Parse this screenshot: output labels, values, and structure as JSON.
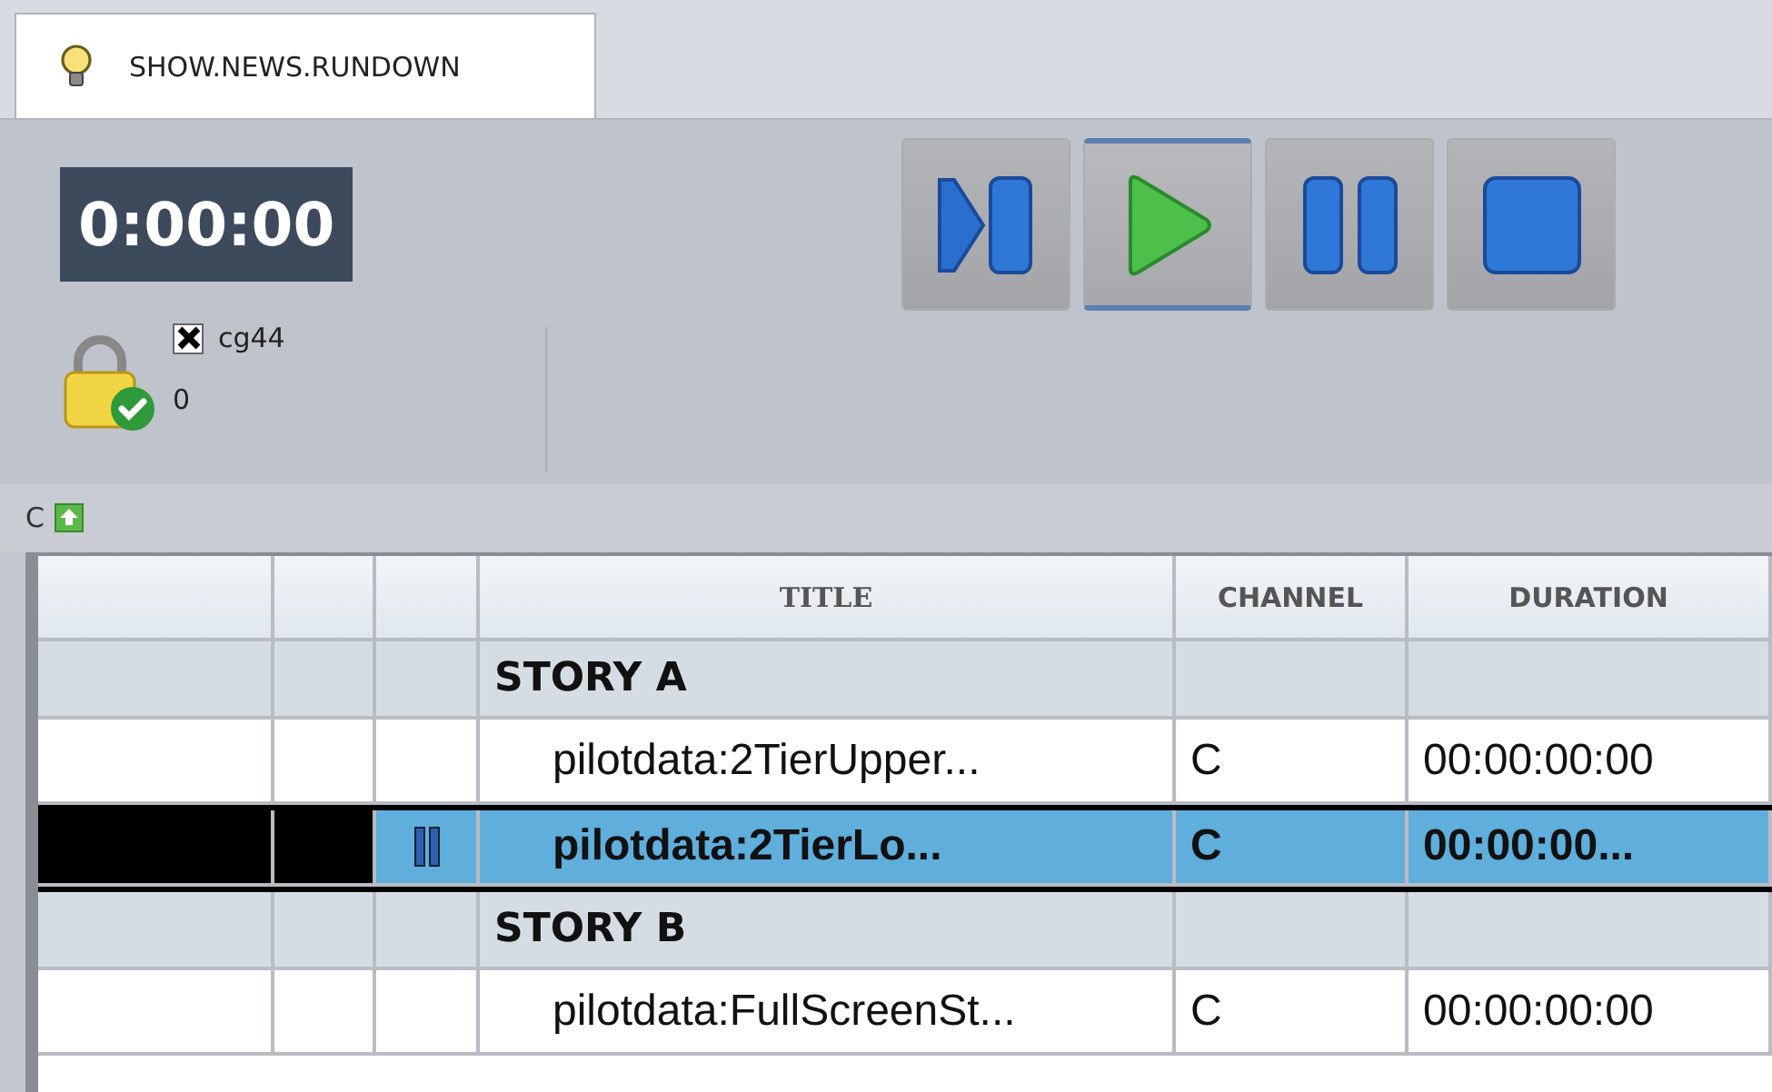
{
  "tab": {
    "label": "SHOW.NEWS.RUNDOWN",
    "selected": true
  },
  "timer": "0:00:00",
  "lock": {
    "checked": true,
    "user": "cg44",
    "count": "0"
  },
  "transport": [
    {
      "kind": "next",
      "selected": false
    },
    {
      "kind": "play",
      "selected": true
    },
    {
      "kind": "pause",
      "selected": false
    },
    {
      "kind": "stop",
      "selected": false
    }
  ],
  "channel_bar": {
    "label": "C"
  },
  "table": {
    "columns": [
      "",
      "",
      "",
      "TITLE",
      "CHANNEL",
      "DURATION"
    ],
    "rows": [
      {
        "kind": "group",
        "title": "STORY A"
      },
      {
        "kind": "item",
        "title": "pilotdata:2TierUpper...",
        "channel": "C",
        "duration": "00:00:00:00",
        "selected": false,
        "paused": false
      },
      {
        "kind": "item",
        "title": "pilotdata:2TierLo...",
        "channel": "C",
        "duration": "00:00:00...",
        "selected": true,
        "paused": true
      },
      {
        "kind": "group",
        "title": "STORY B"
      },
      {
        "kind": "item",
        "title": "pilotdata:FullScreenSt...",
        "channel": "C",
        "duration": "00:00:00:00",
        "selected": false,
        "paused": false
      }
    ]
  }
}
